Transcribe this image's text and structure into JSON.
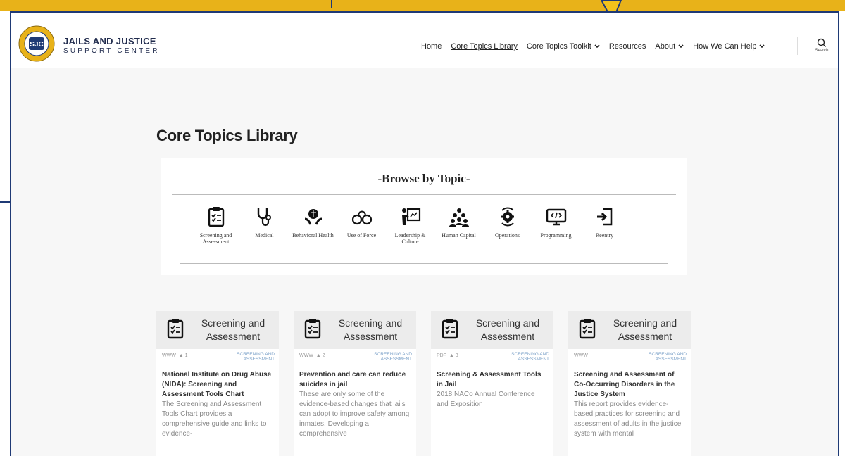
{
  "brand": {
    "line1": "JAILS AND JUSTICE",
    "line2": "SUPPORT CENTER",
    "seal_text": "JAILS AND JUSTICE SUPPORT CENTER"
  },
  "nav": {
    "items": [
      {
        "label": "Home",
        "dropdown": false,
        "active": false
      },
      {
        "label": "Core Topics Library",
        "dropdown": false,
        "active": true
      },
      {
        "label": "Core Topics Toolkit",
        "dropdown": true,
        "active": false
      },
      {
        "label": "Resources",
        "dropdown": false,
        "active": false
      },
      {
        "label": "About",
        "dropdown": true,
        "active": false
      },
      {
        "label": "How We Can Help",
        "dropdown": true,
        "active": false
      }
    ],
    "search_label": "Search"
  },
  "page_title": "Core Topics Library",
  "browse": {
    "title": "-Browse by Topic-",
    "topics": [
      {
        "label": "Screening and Assessment",
        "icon": "clipboard-icon"
      },
      {
        "label": "Medical",
        "icon": "stethoscope-icon"
      },
      {
        "label": "Behavioral Health",
        "icon": "brain-hands-icon"
      },
      {
        "label": "Use of Force",
        "icon": "handcuffs-icon"
      },
      {
        "label": "Leadership & Culture",
        "icon": "presenter-icon"
      },
      {
        "label": "Human Capital",
        "icon": "people-icon"
      },
      {
        "label": "Operations",
        "icon": "gear-icon"
      },
      {
        "label": "Programming",
        "icon": "monitor-code-icon"
      },
      {
        "label": "Reentry",
        "icon": "sign-in-icon"
      }
    ]
  },
  "cards": [
    {
      "category_heading": "Screening and Assessment",
      "type": "WWW",
      "rank": "1",
      "category_tag": "SCREENING AND ASSESSMENT",
      "title": "National Institute on Drug Abuse (NIDA): Screening and Assessment Tools Chart",
      "description": "The Screening and Assessment Tools Chart provides a comprehensive guide and links to evidence-"
    },
    {
      "category_heading": "Screening and Assessment",
      "type": "WWW",
      "rank": "2",
      "category_tag": "SCREENING AND ASSESSMENT",
      "title": "Prevention and care can reduce suicides in jail",
      "description": "These are only some of the evidence-based changes that jails can adopt to improve safety among inmates. Developing a comprehensive"
    },
    {
      "category_heading": "Screening and Assessment",
      "type": "PDF",
      "rank": "3",
      "category_tag": "SCREENING AND ASSESSMENT",
      "title": "Screening & Assessment Tools in Jail",
      "description": "2018 NACo Annual Conference and Exposition"
    },
    {
      "category_heading": "Screening and Assessment",
      "type": "WWW",
      "rank": "",
      "category_tag": "SCREENING AND ASSESSMENT",
      "title": "Screening and Assessment of Co-Occurring Disorders in the Justice System",
      "description": "This report provides evidence-based practices for screening and assessment of adults in the justice system with mental"
    }
  ],
  "colors": {
    "gold": "#e8b219",
    "navy": "#1f3a75",
    "brand_text": "#1f2a4c"
  }
}
